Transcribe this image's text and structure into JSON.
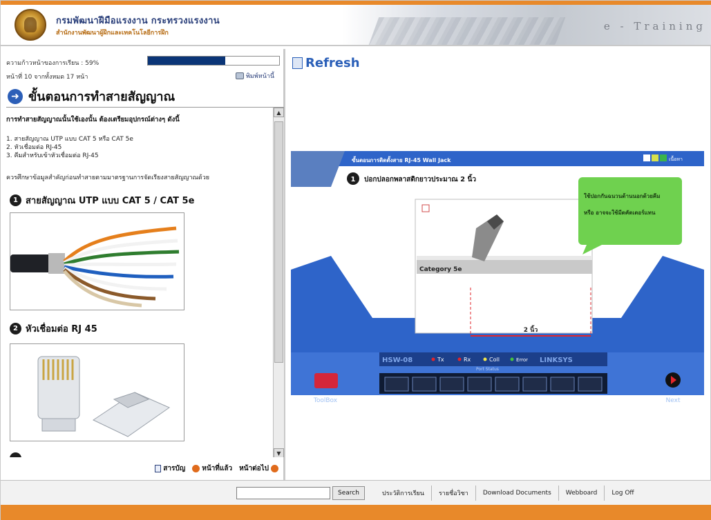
{
  "header": {
    "title": "กรมพัฒนาฝีมือแรงงาน กระทรวงแรงงาน",
    "subtitle": "สำนักงานพัฒนาผู้ฝึกและเทคโนโลยีการฝึก",
    "brand": "e - Training"
  },
  "progress": {
    "label": "ความก้าวหน้าของการเรียน : 59%",
    "percent": 59,
    "page_count": "หน้าที่ 10 จากทั้งหมด 17 หน้า",
    "print_label": "พิมพ์หน้านี้"
  },
  "lesson": {
    "title": "ขั้นตอนการทำสายสัญญาณ",
    "intro": "การทำสายสัญญาณนั้นใช้เองนั้น ต้องเตรียมอุปกรณ์ต่างๆ ดังนี้",
    "items": [
      "1. สายสัญญาณ UTP แบบ CAT 5 หรือ CAT 5e",
      "2. หัวเชื่อมต่อ RJ-45",
      "3. คีมสำหรับเข้าหัวเชื่อมต่อ RJ-45"
    ],
    "note": "ควรศึกษาข้อมูลสำคัญก่อนทำสายตามมาตรฐานการจัดเรียงสายสัญญาณด้วย",
    "sections": [
      {
        "num": "1",
        "heading": "สายสัญญาณ UTP แบบ CAT 5 / CAT 5e"
      },
      {
        "num": "2",
        "heading": "หัวเชื่อมต่อ RJ 45"
      }
    ]
  },
  "footer_nav": {
    "contents": "สารบัญ",
    "prev": "หน้าที่แล้ว",
    "next": "หน้าต่อไป"
  },
  "right": {
    "refresh": "Refresh"
  },
  "flash": {
    "banner": "ขั้นตอนการติดตั้งสาย RJ-45 Wall Jack",
    "step_num": "1",
    "step_text": "ปอกปลอกพลาสติกยาวประมาณ 2 นิ้ว",
    "tip": "ใช้ปอกกันฉนวนด้านนอกด้วยคีม หรือ อาจจะใช้มีดคัตเตอร์แทน",
    "cable_label": "Category 5e",
    "measure_label": "2 นิ้ว",
    "switch_model": "HSW-08",
    "legend": [
      "Tx",
      "Rx",
      "Coll",
      "Error"
    ],
    "port_status": "Port Status",
    "vendor": "LINKSYS",
    "toolbox": "ToolBox",
    "next": "Next",
    "corner_label": "เนื้อหา",
    "colors": {
      "blue": "#2e64c9",
      "tx": "#e2252b",
      "rx": "#e2252b",
      "coll": "#f4e64a",
      "error": "#46c43c"
    }
  },
  "bottom": {
    "search_button": "Search",
    "search_value": "",
    "links": [
      "ประวัติการเรียน",
      "รายชื่อวิชา",
      "Download Documents",
      "Webboard",
      "Log Off"
    ]
  }
}
